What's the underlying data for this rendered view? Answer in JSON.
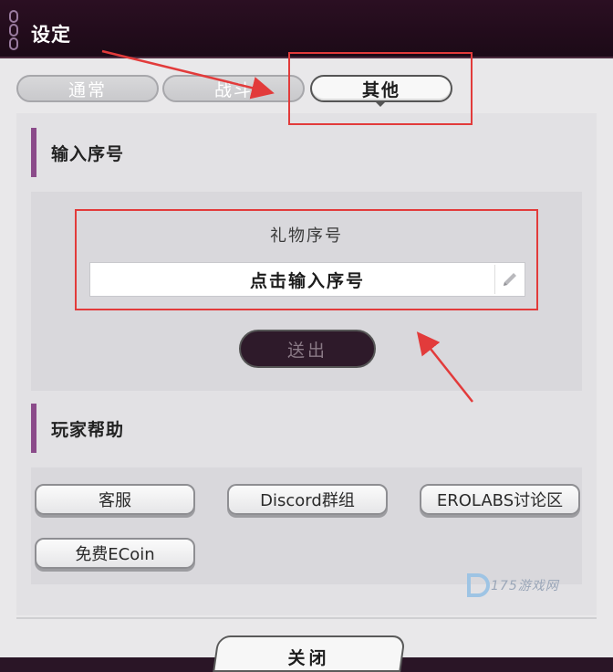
{
  "title": "设定",
  "tabs": [
    {
      "label": "通常",
      "active": false
    },
    {
      "label": "战斗",
      "active": false
    },
    {
      "label": "其他",
      "active": true
    }
  ],
  "serial_section": {
    "heading": "输入序号",
    "gift_label": "礼物序号",
    "input_placeholder": "点击输入序号",
    "send_label": "送出"
  },
  "help_section": {
    "heading": "玩家帮助",
    "buttons": [
      {
        "label": "客服"
      },
      {
        "label": "Discord群组"
      },
      {
        "label": "EROLABS讨论区"
      },
      {
        "label": "免费ECoin"
      }
    ]
  },
  "close_label": "关闭",
  "watermark": "175游戏网",
  "icons": {
    "chain": "chain-icon",
    "edit": "pencil-icon"
  },
  "colors": {
    "titlebar": "#1c0a17",
    "accent_bar": "#8b4b8a",
    "annotation": "#e23b3b",
    "send_button": "#2e1a2a"
  }
}
